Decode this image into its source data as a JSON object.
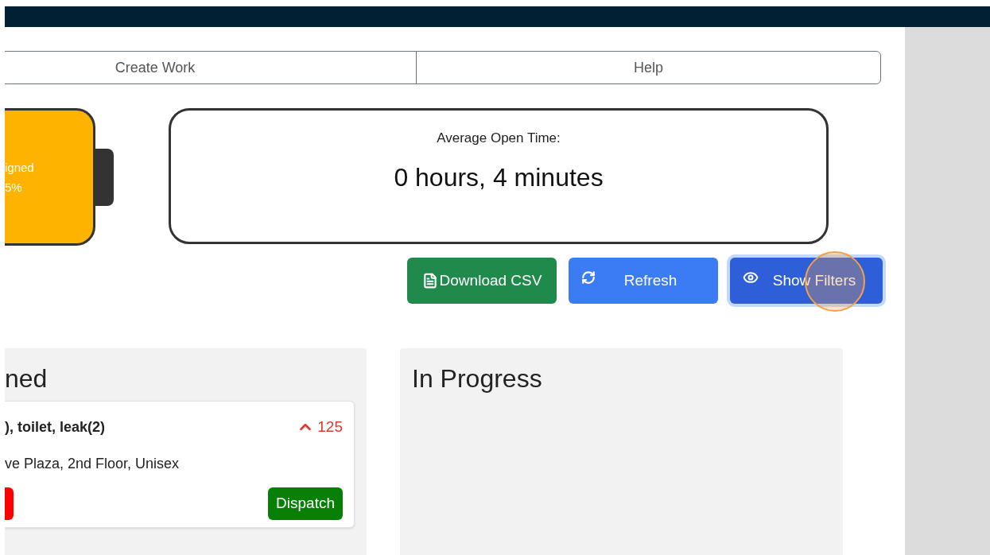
{
  "nav": [
    {
      "label": "Create Work"
    },
    {
      "label": "Help"
    }
  ],
  "status_card": {
    "label": "igned",
    "percent": "5%"
  },
  "average_card": {
    "label": "Average Open Time:",
    "value": "0 hours, 4 minutes"
  },
  "actions": [
    {
      "kind": "csv",
      "label": "Download CSV",
      "focused": false
    },
    {
      "kind": "refresh",
      "label": "Refresh",
      "focused": false
    },
    {
      "kind": "filters",
      "label": "Show Filters",
      "focused": true
    }
  ],
  "columns": [
    {
      "title": "ned",
      "cards": [
        {
          "title": "), toilet, leak(2)",
          "count": "125",
          "location": "ve Plaza, 2nd Floor, Unisex",
          "action": "Dispatch"
        }
      ]
    },
    {
      "title": "In Progress"
    }
  ]
}
